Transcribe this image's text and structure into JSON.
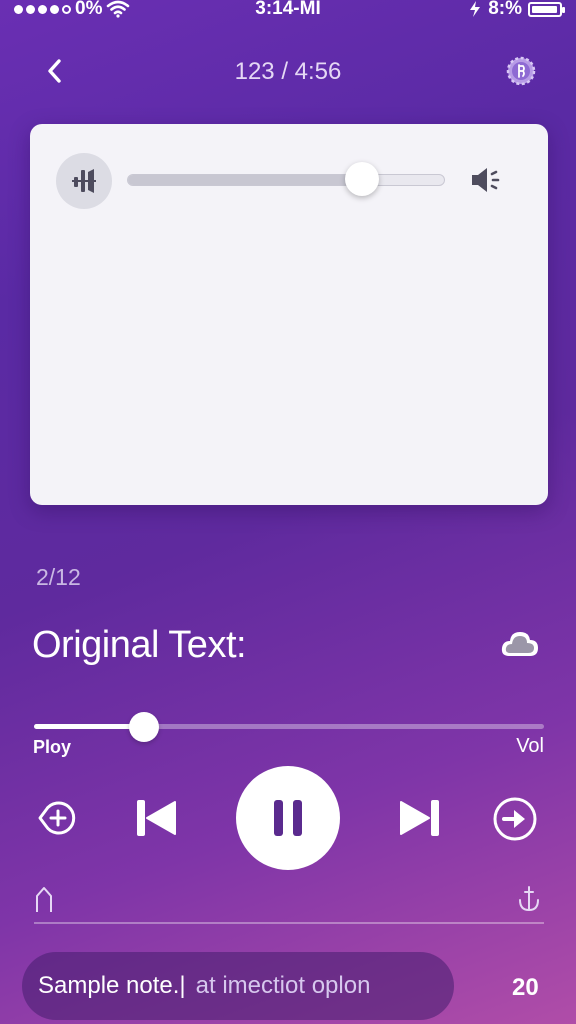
{
  "status_bar": {
    "signal": "0%",
    "time": "3:14-MI",
    "battery_text": "8:%",
    "battery_level": 0.95
  },
  "nav": {
    "title": "123 / 4:56",
    "back_icon": "chevron-left-icon",
    "settings_icon": "settings-icon"
  },
  "card": {
    "volume_level": 0.74,
    "left_icon": "audio-bars-icon",
    "right_icon": "speaker-icon"
  },
  "counter": "2/12",
  "original_text_label": "Original Text:",
  "cloud_icon": "cloud-icon",
  "playback": {
    "progress": 0.215,
    "left_label": "Ploy",
    "right_label": "Vol"
  },
  "controls": {
    "rewind_icon": "add-circle-icon",
    "prev_icon": "skip-previous-icon",
    "play_icon": "pause-icon",
    "next_icon": "skip-next-icon",
    "forward_icon": "arrow-right-circle-icon"
  },
  "note": {
    "value": "Sample note.|",
    "hint": "at imectiot oplon",
    "count": "20"
  },
  "colors": {
    "gradient_start": "#6a2fb3",
    "gradient_end": "#b04da8",
    "card_bg": "#f4f3f8"
  }
}
